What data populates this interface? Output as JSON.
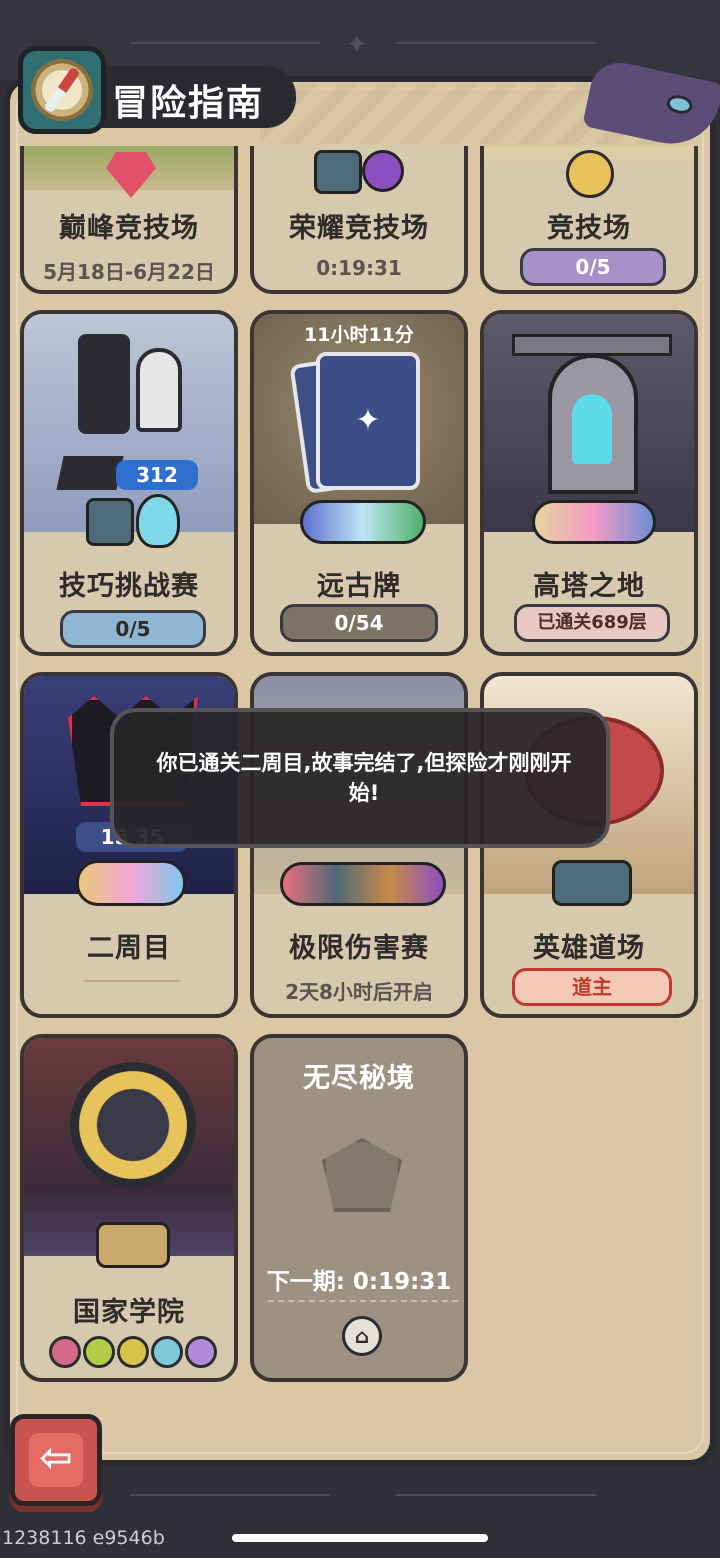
{
  "header": {
    "title": "冒险指南"
  },
  "cards": {
    "peak_arena": {
      "name": "巅峰竞技场",
      "sub": "5月18日-6月22日"
    },
    "glory_arena": {
      "name": "荣耀竞技场",
      "sub": "0:19:31"
    },
    "arena": {
      "name": "竞技场",
      "pill": "0/5"
    },
    "skill_challenge": {
      "name": "技巧挑战赛",
      "badge": "312",
      "pill": "0/5"
    },
    "ancient_cards": {
      "name": "远古牌",
      "timer": "11小时11分",
      "pill": "0/54"
    },
    "tower": {
      "name": "高塔之地",
      "pill": "已通关689层"
    },
    "second_cycle": {
      "name": "二周目",
      "badge": "15  35"
    },
    "damage_limit": {
      "name": "极限伤害赛",
      "sub": "2天8小时后开启"
    },
    "hero_dojo": {
      "name": "英雄道场",
      "pill": "道主"
    },
    "academy": {
      "name": "国家学院"
    },
    "endless": {
      "name": "无尽秘境",
      "next": "下一期: 0:19:31"
    }
  },
  "tooltip": {
    "text": "你已通关二周目,故事完结了,但探险才刚刚开始!"
  },
  "footer": {
    "build": "1238116 e9546b"
  }
}
